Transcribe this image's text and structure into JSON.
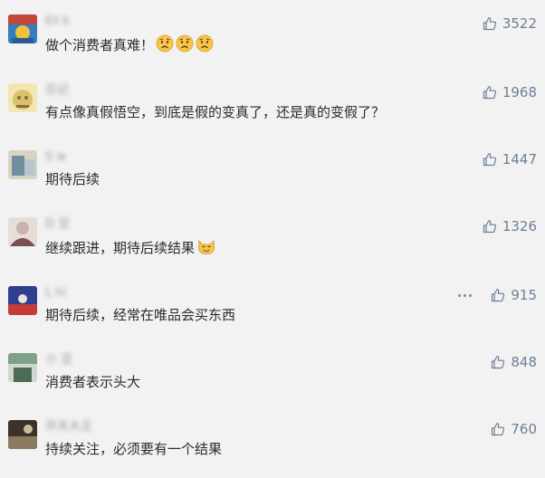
{
  "comments": [
    {
      "username": "Eli   k",
      "text": "做个消费者真难！",
      "emojis": [
        "sad-face",
        "sad-face",
        "sad-face"
      ],
      "likes": "3522",
      "avatar_colors": [
        "#c3453b",
        "#2f7fc1",
        "#f0c23b"
      ]
    },
    {
      "username": "忘记   ",
      "text": "有点像真假悟空，到底是假的变真了，还是真的变假了？",
      "emojis": [],
      "likes": "1968",
      "avatar_colors": [
        "#d9c26a",
        "#8b6a3a",
        "#f3e6b5"
      ]
    },
    {
      "username": "S    w",
      "text": "期待后续",
      "emojis": [],
      "likes": "1447",
      "avatar_colors": [
        "#6f8fa0",
        "#b7c6cc",
        "#d9d4c2"
      ]
    },
    {
      "username": "D   豆",
      "text": "继续跟进，期待后续结果",
      "emojis": [
        "cat-face"
      ],
      "likes": "1326",
      "avatar_colors": [
        "#7a4e52",
        "#c8b1ae",
        "#e6ded6"
      ]
    },
    {
      "username": "L      hi",
      "text": "期待后续，经常在唯品会买东西",
      "emojis": [],
      "likes": "915",
      "avatar_colors": [
        "#2f3f8f",
        "#c43b38",
        "#9aa3c7"
      ]
    },
    {
      "username": "小   豆",
      "text": "消费者表示头大",
      "emojis": [],
      "likes": "848",
      "avatar_colors": [
        "#7fa08a",
        "#cfd8cf",
        "#4e6b58"
      ]
    },
    {
      "username": "开天大王",
      "text": "持续关注，必须要有一个结果",
      "emojis": [],
      "likes": "760",
      "avatar_colors": [
        "#3b3328",
        "#8a7a5f",
        "#c9bca3"
      ]
    }
  ],
  "colors": {
    "background": "#f2f2f2",
    "text": "#2b2b2b",
    "like_accent": "#6b7f96"
  },
  "icons": {
    "like": "thumbs-up-icon",
    "more": "more-options-icon"
  }
}
